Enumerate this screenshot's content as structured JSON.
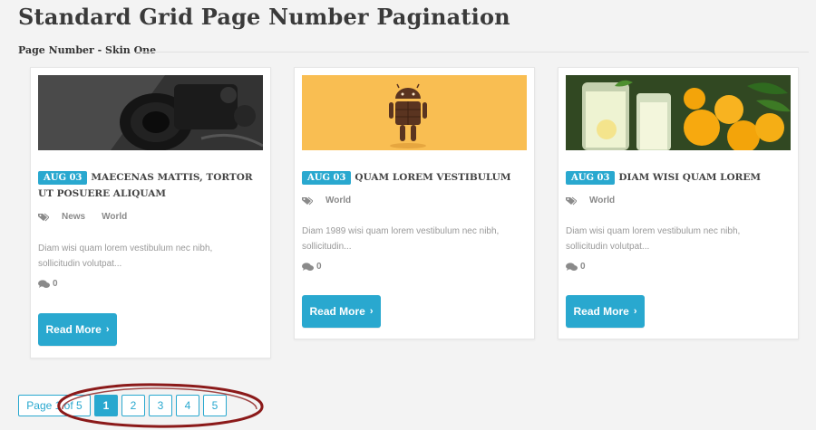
{
  "page": {
    "title": "Standard Grid Page Number Pagination",
    "section_label": "Page Number - Skin One"
  },
  "posts": [
    {
      "date": "AUG 03",
      "title": "MAECENAS MATTIS, TORTOR UT POSUERE ALIQUAM",
      "tags": [
        "News",
        "World"
      ],
      "excerpt": "Diam wisi quam lorem vestibulum nec nibh, sollicitudin volutpat...",
      "comments": "0",
      "read_more": "Read More",
      "image": "camera-photo"
    },
    {
      "date": "AUG 03",
      "title": "QUAM LOREM VESTIBULUM",
      "tags": [
        "World"
      ],
      "excerpt": "Diam 1989 wisi quam lorem vestibulum nec nibh, sollicitudin...",
      "comments": "0",
      "read_more": "Read More",
      "image": "android-chocolate-photo"
    },
    {
      "date": "AUG 03",
      "title": "DIAM WISI QUAM LOREM",
      "tags": [
        "World"
      ],
      "excerpt": "Diam wisi quam lorem vestibulum nec nibh, sollicitudin volutpat...",
      "comments": "0",
      "read_more": "Read More",
      "image": "lemonade-photo"
    }
  ],
  "pagination": {
    "info": "Page 1 of 5",
    "pages": [
      "1",
      "2",
      "3",
      "4",
      "5"
    ],
    "current": "1"
  },
  "colors": {
    "accent": "#29a8cf",
    "annotation": "#8b1a1a"
  },
  "icons": {
    "tag": "tags-icon",
    "comment": "comments-icon",
    "chevron": "chevron-right-icon"
  }
}
